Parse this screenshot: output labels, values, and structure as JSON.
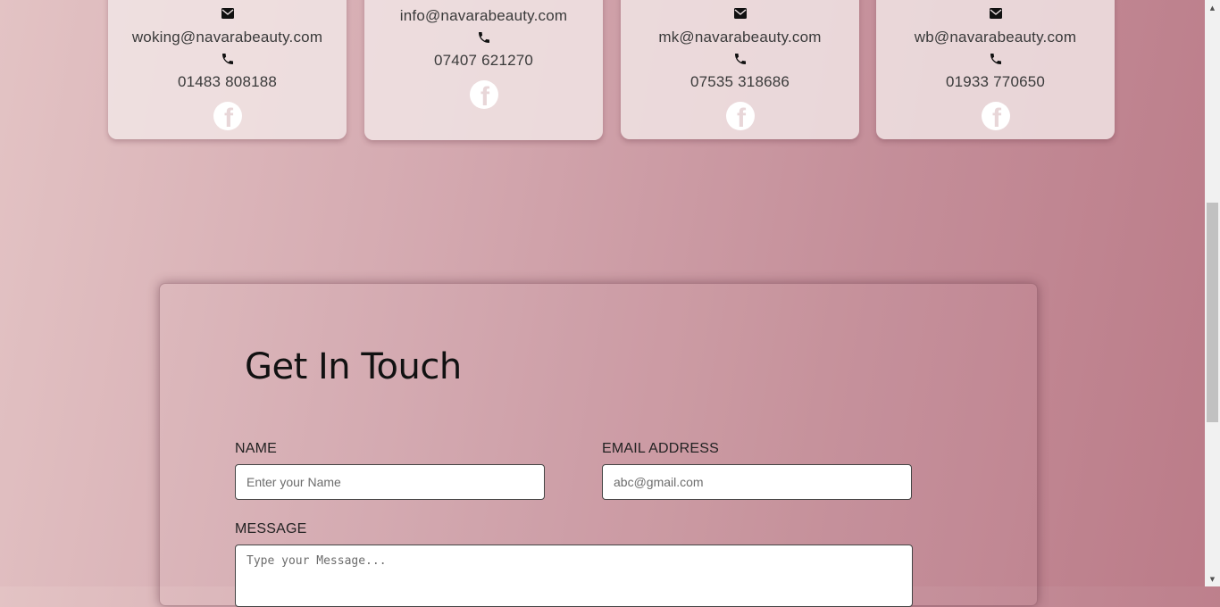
{
  "locations": [
    {
      "email": "woking@navarabeauty.com",
      "phone": "01483 808188"
    },
    {
      "email": "info@navarabeauty.com",
      "phone": "07407 621270"
    },
    {
      "email": "mk@navarabeauty.com",
      "phone": "07535 318686"
    },
    {
      "email": "wb@navarabeauty.com",
      "phone": "01933 770650"
    }
  ],
  "contact_form": {
    "title": "Get In Touch",
    "name_label": "NAME",
    "name_placeholder": "Enter your Name",
    "email_label": "EMAIL ADDRESS",
    "email_placeholder": "abc@gmail.com",
    "message_label": "MESSAGE",
    "message_placeholder": "Type your Message..."
  },
  "icons": {
    "email": "envelope-icon",
    "phone": "phone-icon",
    "social": "facebook-icon"
  }
}
